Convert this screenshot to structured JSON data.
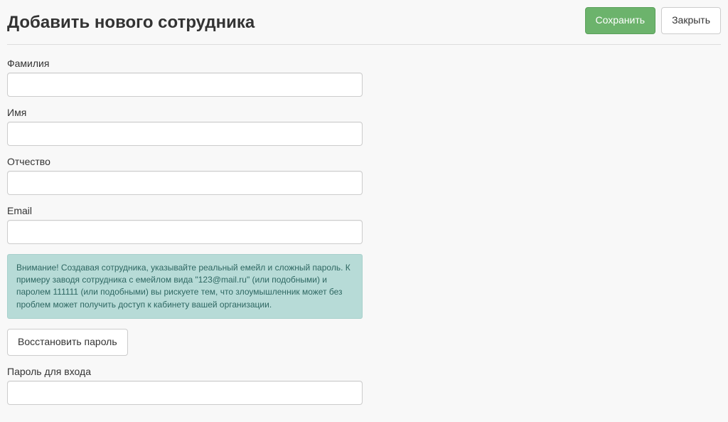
{
  "header": {
    "title": "Добавить нового сотрудника",
    "save_label": "Сохранить",
    "close_label": "Закрыть"
  },
  "form": {
    "last_name": {
      "label": "Фамилия",
      "value": ""
    },
    "first_name": {
      "label": "Имя",
      "value": ""
    },
    "patronymic": {
      "label": "Отчество",
      "value": ""
    },
    "email": {
      "label": "Email",
      "value": ""
    },
    "warning_text": "Внимание! Создавая сотрудника, указывайте реальный емейл и сложный пароль. К примеру заводя сотрудника с емейлом вида \"123@mail.ru\" (или подобными) и паролем 111111 (или подобными) вы рискуете тем, что злоумышленник может без проблем может получить доступ к кабинету вашей организации.",
    "restore_password_label": "Восстановить пароль",
    "password": {
      "label": "Пароль для входа",
      "value": ""
    }
  }
}
